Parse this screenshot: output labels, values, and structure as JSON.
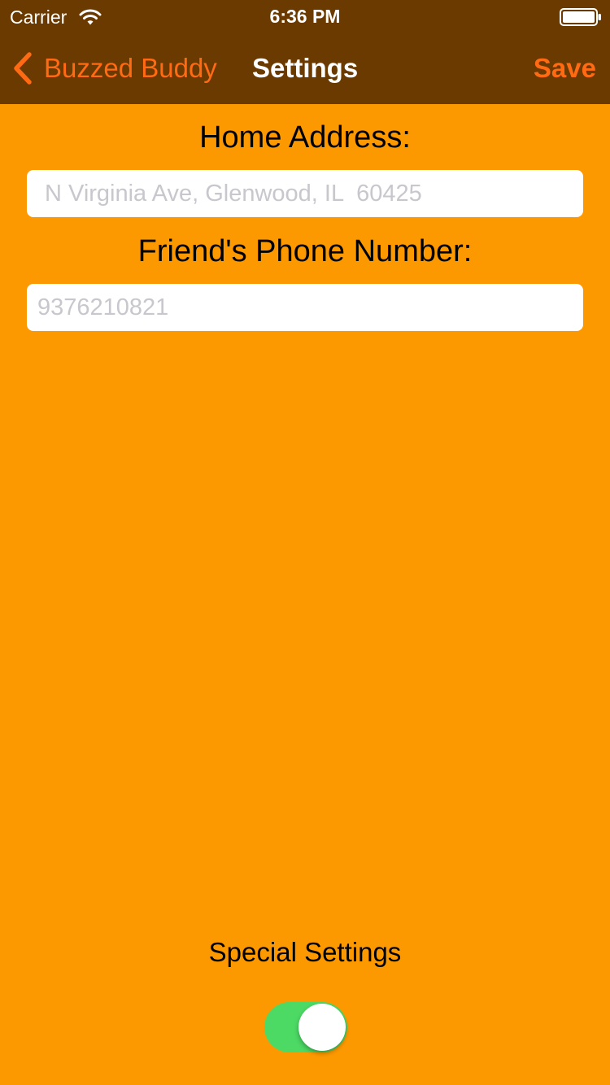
{
  "status_bar": {
    "carrier": "Carrier",
    "wifi_icon": "wifi-icon",
    "time": "6:36 PM",
    "battery_icon": "battery-icon"
  },
  "nav_bar": {
    "back_icon": "chevron-left-icon",
    "back_label": "Buzzed Buddy",
    "title": "Settings",
    "save_label": "Save"
  },
  "form": {
    "address_label": "Home Address:",
    "address_placeholder": "N Virginia Ave, Glenwood, IL  60425",
    "address_value": "",
    "phone_label": "Friend's Phone Number:",
    "phone_placeholder": "9376210821",
    "phone_value": ""
  },
  "special_settings": {
    "label": "Special Settings",
    "enabled": true
  },
  "colors": {
    "nav_background": "#6B3A00",
    "page_background": "#FD9900",
    "accent": "#FF6A13",
    "toggle_on": "#4CD964"
  }
}
